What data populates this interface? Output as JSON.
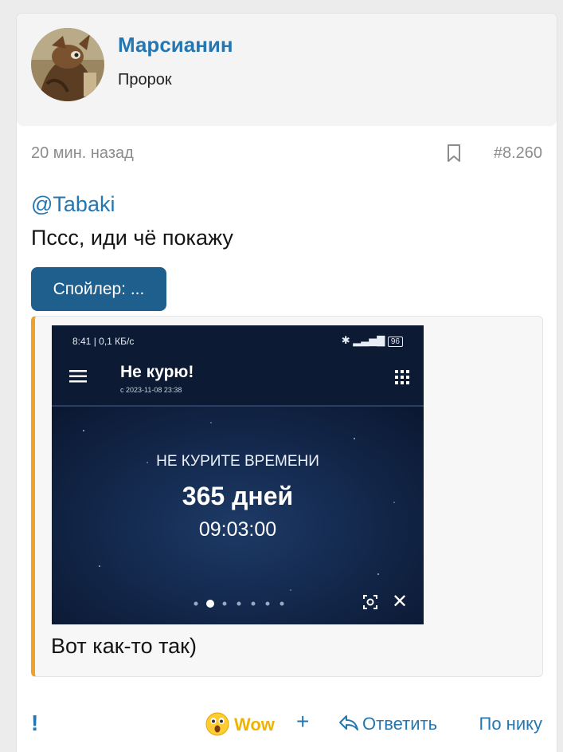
{
  "author": {
    "username": "Марсианин",
    "title": "Пророк",
    "avatar_icon": "martian-avatar"
  },
  "meta": {
    "time": "20 мин. назад",
    "post_number": "#8.260",
    "bookmark_icon": "bookmark-icon"
  },
  "message": {
    "mention": "@Tabaki",
    "text": "Пссс, иди чё покажу",
    "spoiler_button": "Спойлер: ...",
    "caption": "Вот как-то так)"
  },
  "screenshot": {
    "status_left": "8:41 | 0,1 КБ/с",
    "status_right": "96",
    "app_title": "Не курю!",
    "app_subtitle": "с 2023-11-08 23:38",
    "timer_heading": "НЕ КУРИТЕ ВРЕМЕНИ",
    "timer_days": "365 дней",
    "timer_time": "09:03:00",
    "active_dot": 2,
    "dot_count": 7
  },
  "footer": {
    "report_icon": "!",
    "reaction_label": "Wow",
    "add_label": "+",
    "reply_label": "Ответить",
    "by_nick_label": "По нику"
  },
  "colors": {
    "accent": "#2577b1",
    "spoiler_bg": "#1f5f8e",
    "spoiler_border": "#f0a12b",
    "wow": "#f0b400"
  }
}
